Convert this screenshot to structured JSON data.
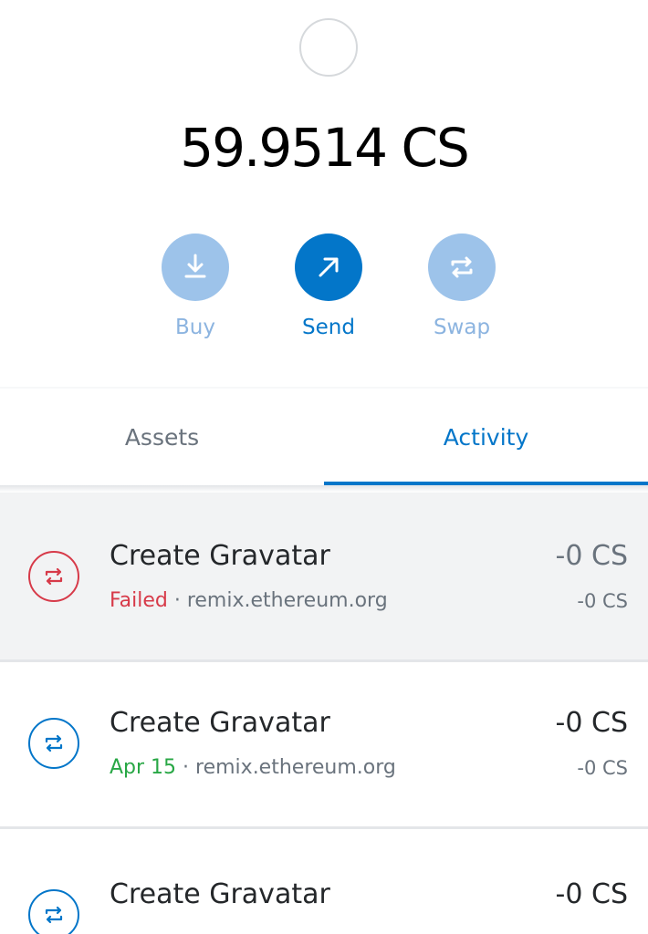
{
  "balance": "59.9514 CS",
  "actions": {
    "buy": "Buy",
    "send": "Send",
    "swap": "Swap"
  },
  "tabs": {
    "assets": "Assets",
    "activity": "Activity"
  },
  "transactions": [
    {
      "title": "Create Gravatar",
      "status": "Failed",
      "separator": " · ",
      "origin": "remix.ethereum.org",
      "amount": "-0 CS",
      "amount_secondary": "-0 CS",
      "status_color": "#d73a49"
    },
    {
      "title": "Create Gravatar",
      "status": "Apr 15",
      "separator": " · ",
      "origin": "remix.ethereum.org",
      "amount": "-0 CS",
      "amount_secondary": "-0 CS",
      "status_color": "#28a745"
    },
    {
      "title": "Create Gravatar",
      "amount": "-0 CS"
    }
  ],
  "colors": {
    "accent": "#0376c9",
    "accent_light": "#9dc3ea",
    "failed": "#d73a49",
    "confirmed": "#28a745"
  }
}
